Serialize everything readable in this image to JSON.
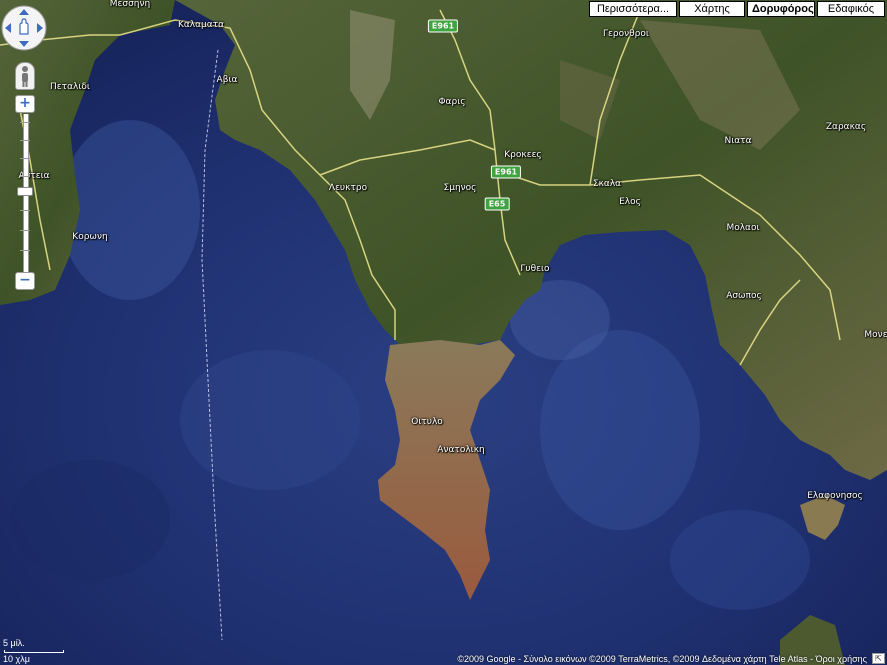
{
  "map_types": {
    "more": "Περισσότερα...",
    "map": "Χάρτης",
    "satellite": "Δορυφόρος",
    "terrain": "Εδαφικός",
    "active": "satellite"
  },
  "places": {
    "kalamata": "Καλαματα",
    "messini": "Μεσσηνη",
    "avia": "Αβια",
    "petalidi": "Πεταλιδι",
    "koroni": "Κορωνη",
    "kastania": "Αστεια",
    "leuktro": "Λευκτρο",
    "faris": "Φαρις",
    "smynos": "Σμηνος",
    "krokees": "Κροκεες",
    "gytheio": "Γυθειο",
    "skala": "Σκαλα",
    "elos": "Ελος",
    "gerontrhoi": "Γερονθροι",
    "niata": "Νιατα",
    "zarakas": "Ζαρακας",
    "molaoi": "Μολαοι",
    "asopos": "Ασωπος",
    "oitylo": "Οιτυλο",
    "anatoliki": "Ανατολικη",
    "elafonisos": "Ελαφονησος",
    "monemvasia": "Μονε"
  },
  "road_shields": {
    "e961_top": "E961",
    "e961_mid": "E961",
    "e65": "E65"
  },
  "scale": {
    "top_label": "5 μίλ.",
    "bottom_label": "10 χλμ"
  },
  "copyright": "©2009 Google - Σύνολο εικόνων ©2009 TerraMetrics, ©2009 Δεδομένα χάρτη Tele Atlas - Όροι χρήσης",
  "watermark": "© 2009 Google",
  "colors": {
    "sea": "#22336e",
    "land": "#4a5a2e",
    "roads": "#e8e08a"
  }
}
